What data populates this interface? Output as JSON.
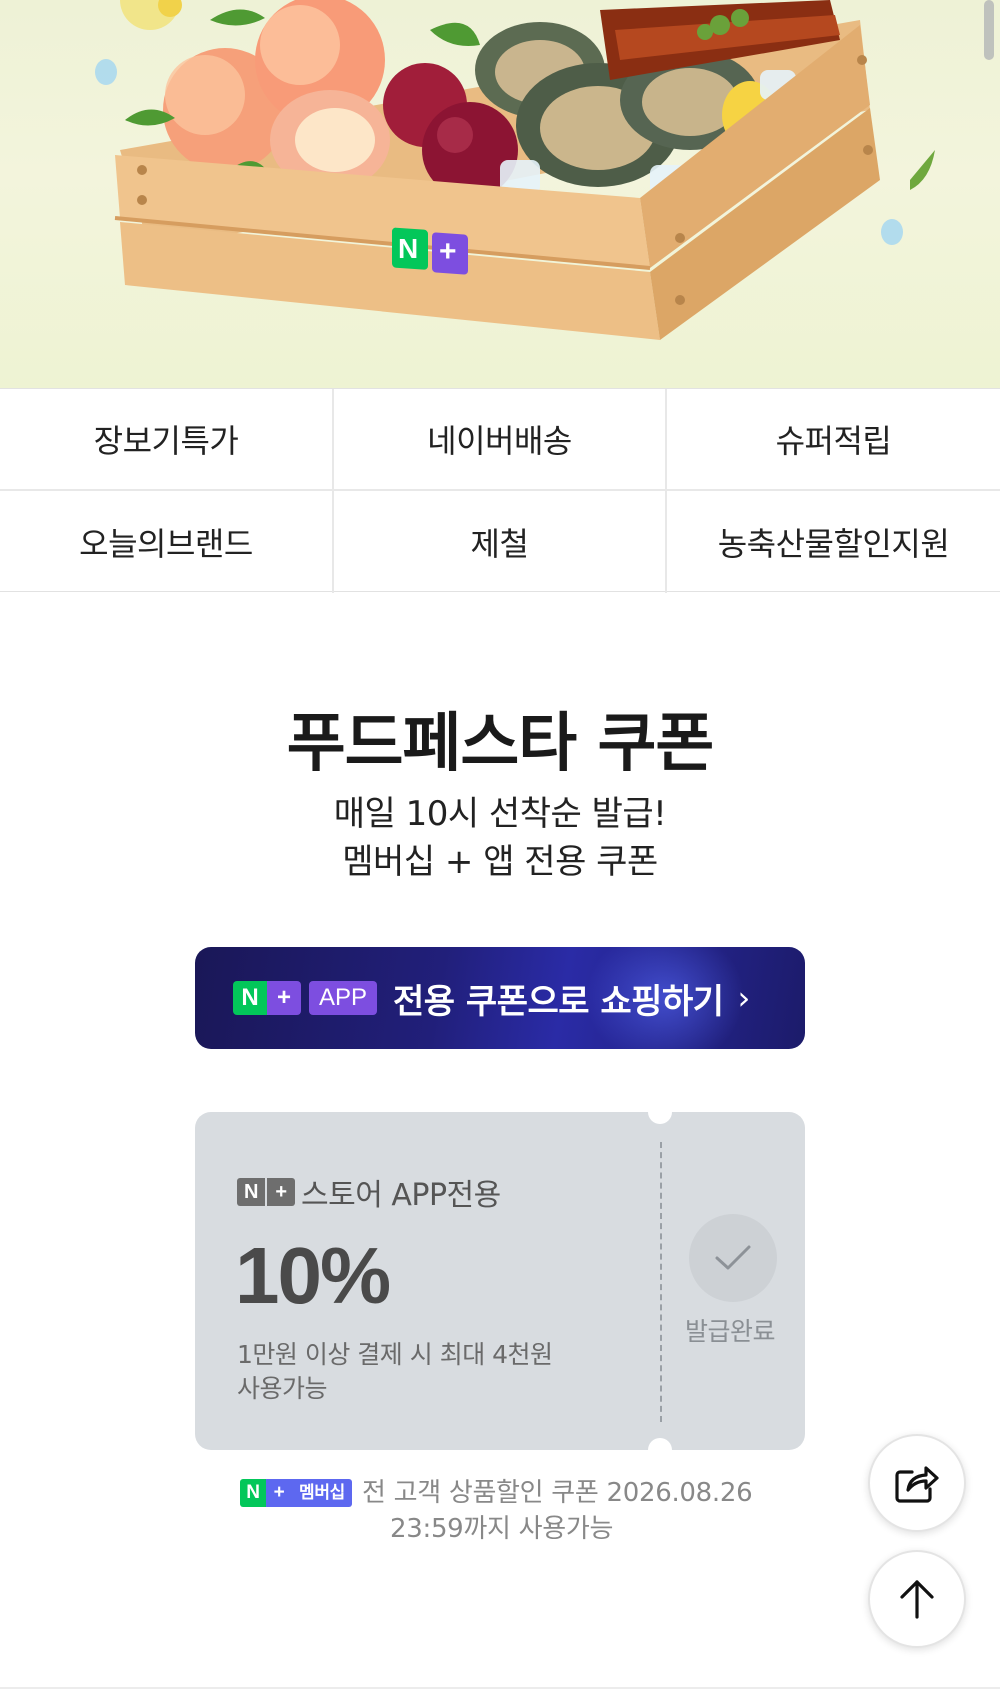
{
  "hero": {
    "box_logo_n": "N",
    "box_logo_plus": "+"
  },
  "categories": [
    {
      "label": "장보기특가"
    },
    {
      "label": "네이버배송"
    },
    {
      "label": "슈퍼적립"
    },
    {
      "label": "오늘의브랜드"
    },
    {
      "label": "제철"
    },
    {
      "label": "농축산물할인지원"
    }
  ],
  "festa": {
    "title": "푸드페스타 쿠폰",
    "subtitle_line1": "매일 10시 선착순 발급!",
    "subtitle_line2": "멤버십 + 앱 전용 쿠폰"
  },
  "app_banner": {
    "logo_n": "N",
    "logo_plus": "+",
    "app_tag": "APP",
    "label": "전용 쿠폰으로 쇼핑하기",
    "chevron": "›"
  },
  "coupon": {
    "logo_n": "N",
    "logo_plus": "+",
    "store_label": "스토어 APP전용",
    "discount": "10%",
    "condition_line1": "1만원 이상 결제 시 최대 4천원",
    "condition_line2": "사용가능",
    "status": "발급완료"
  },
  "membership_note": {
    "badge_n": "N",
    "badge_plus": "+",
    "badge_label": "멤버십",
    "line1": "전 고객 상품할인 쿠폰 2026.08.26",
    "line2": "23:59까지 사용가능"
  },
  "icons": {
    "share": "share-icon",
    "scroll_top": "arrow-up-icon",
    "check": "check-icon"
  },
  "colors": {
    "naver_green": "#03c75a",
    "plus_purple": "#7d4ee0",
    "banner_navy": "#1a1757",
    "coupon_gray": "#d8dce0"
  }
}
